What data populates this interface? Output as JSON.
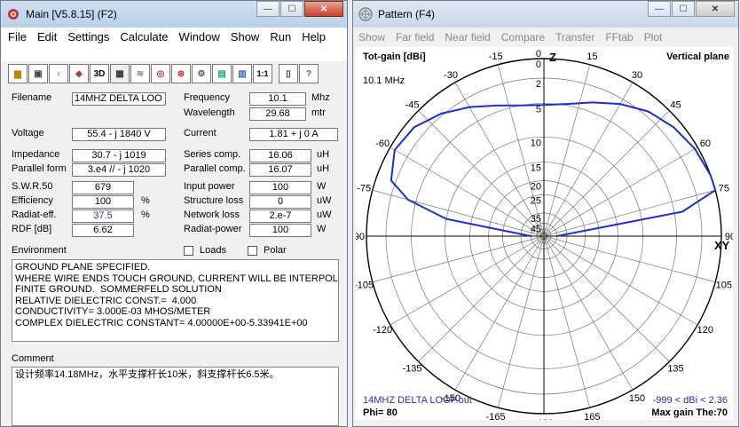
{
  "main": {
    "title": "Main [V5.8.15]  (F2)",
    "menu": [
      "File",
      "Edit",
      "Settings",
      "Calculate",
      "Window",
      "Show",
      "Run",
      "Help"
    ],
    "toolbar": [
      "folder-icon",
      "windows-icon",
      "bulb-icon",
      "cube-icon",
      "3d-icon",
      "grid-icon",
      "wave-icon",
      "target-icon",
      "dial-icon",
      "gear-icon",
      "calc-icon",
      "table-icon",
      "scale-icon",
      "book-icon",
      "help-icon"
    ],
    "toolbar_text": {
      "3d": "3D",
      "scale": "1:1",
      "help": "?"
    },
    "filename_label": "Filename",
    "filename": "14MHZ DELTA LOO",
    "frequency_label": "Frequency",
    "frequency": "10.1",
    "frequency_unit": "Mhz",
    "wavelength_label": "Wavelength",
    "wavelength": "29.68",
    "wavelength_unit": "mtr",
    "voltage_label": "Voltage",
    "voltage": "55.4 - j 1840 V",
    "current_label": "Current",
    "current": "1.81 + j 0 A",
    "impedance_label": "Impedance",
    "impedance": "30.7 - j 1019",
    "parallel_form_label": "Parallel form",
    "parallel_form": "3.e4 // - j 1020",
    "series_comp_label": "Series comp.",
    "series_comp": "16.06",
    "series_comp_unit": "uH",
    "parallel_comp_label": "Parallel comp.",
    "parallel_comp": "16.07",
    "parallel_comp_unit": "uH",
    "swr_label": "S.W.R.50",
    "swr": "679",
    "efficiency_label": "Efficiency",
    "efficiency": "100",
    "efficiency_unit": "%",
    "radiat_eff_label": "Radiat-eff.",
    "radiat_eff": "37.5",
    "radiat_eff_unit": "%",
    "rdf_label": "RDF [dB]",
    "rdf": "6.62",
    "input_power_label": "Input power",
    "input_power": "100",
    "input_power_unit": "W",
    "structure_loss_label": "Structure loss",
    "structure_loss": "0",
    "structure_loss_unit": "uW",
    "network_loss_label": "Network loss",
    "network_loss": "2.e-7",
    "network_loss_unit": "uW",
    "radiat_power_label": "Radiat-power",
    "radiat_power": "100",
    "radiat_power_unit": "W",
    "environment_label": "Environment",
    "loads_label": "Loads",
    "polar_label": "Polar",
    "environment_text": "GROUND PLANE SPECIFIED.\nWHERE WIRE ENDS TOUCH GROUND, CURRENT WILL BE INTERPOLA\nFINITE GROUND.  SOMMERFELD SOLUTION\nRELATIVE DIELECTRIC CONST.=  4.000\nCONDUCTIVITY= 3.000E-03 MHOS/METER\nCOMPLEX DIELECTRIC CONSTANT= 4.00000E+00-5.33941E+00",
    "comment_label": "Comment",
    "comment_text": "设计频率14.18MHz，水平支撑杆长10米，斜支撑杆长6.5米。"
  },
  "pattern": {
    "title": "Pattern   (F4)",
    "menu": [
      "Show",
      "Far field",
      "Near field",
      "Compare",
      "Transfer",
      "FFtab",
      "Plot"
    ],
    "tot_gain": "Tot-gain [dBi]",
    "vertical_plane": "Vertical plane",
    "freq": "10.1 MHz",
    "z_label": "Z",
    "xy_label": "XY",
    "filename": "14MHZ DELTA LOOP.out",
    "dbi_range": "-999 < dBi < 2.36",
    "phi": "Phi= 80",
    "max_gain": "Max gain The:70",
    "ring_labels": [
      "0",
      "2",
      "5",
      "10",
      "15",
      "20",
      "25",
      "35",
      "45"
    ],
    "ring_values": [
      0,
      -2,
      -5,
      -10,
      -15,
      -20,
      -25,
      -35,
      -45
    ],
    "angle_labels": [
      "-90",
      "-75",
      "-60",
      "-45",
      "-30",
      "-15",
      "0",
      "15",
      "30",
      "45",
      "60",
      "75",
      "90",
      "105",
      "120",
      "135",
      "150",
      "165",
      "-180",
      "-165",
      "-150",
      "-135",
      "-120",
      "-105"
    ],
    "pattern_color": "#1a2fcf",
    "pattern_gain_dbi": {
      "theta": [
        -90,
        -80,
        -75,
        -70,
        -60,
        -50,
        -40,
        -30,
        -20,
        -10,
        0,
        10,
        20,
        30,
        40,
        50,
        60,
        70,
        75,
        80,
        90
      ],
      "gain": [
        -45,
        -10,
        -4,
        -1.5,
        -0.5,
        -0.8,
        -1.8,
        -3,
        -4.2,
        -5,
        -5.2,
        -4.8,
        -3.8,
        -2.6,
        -1.5,
        -0.8,
        -0.3,
        0.5,
        2.36,
        -4,
        -45
      ]
    }
  }
}
